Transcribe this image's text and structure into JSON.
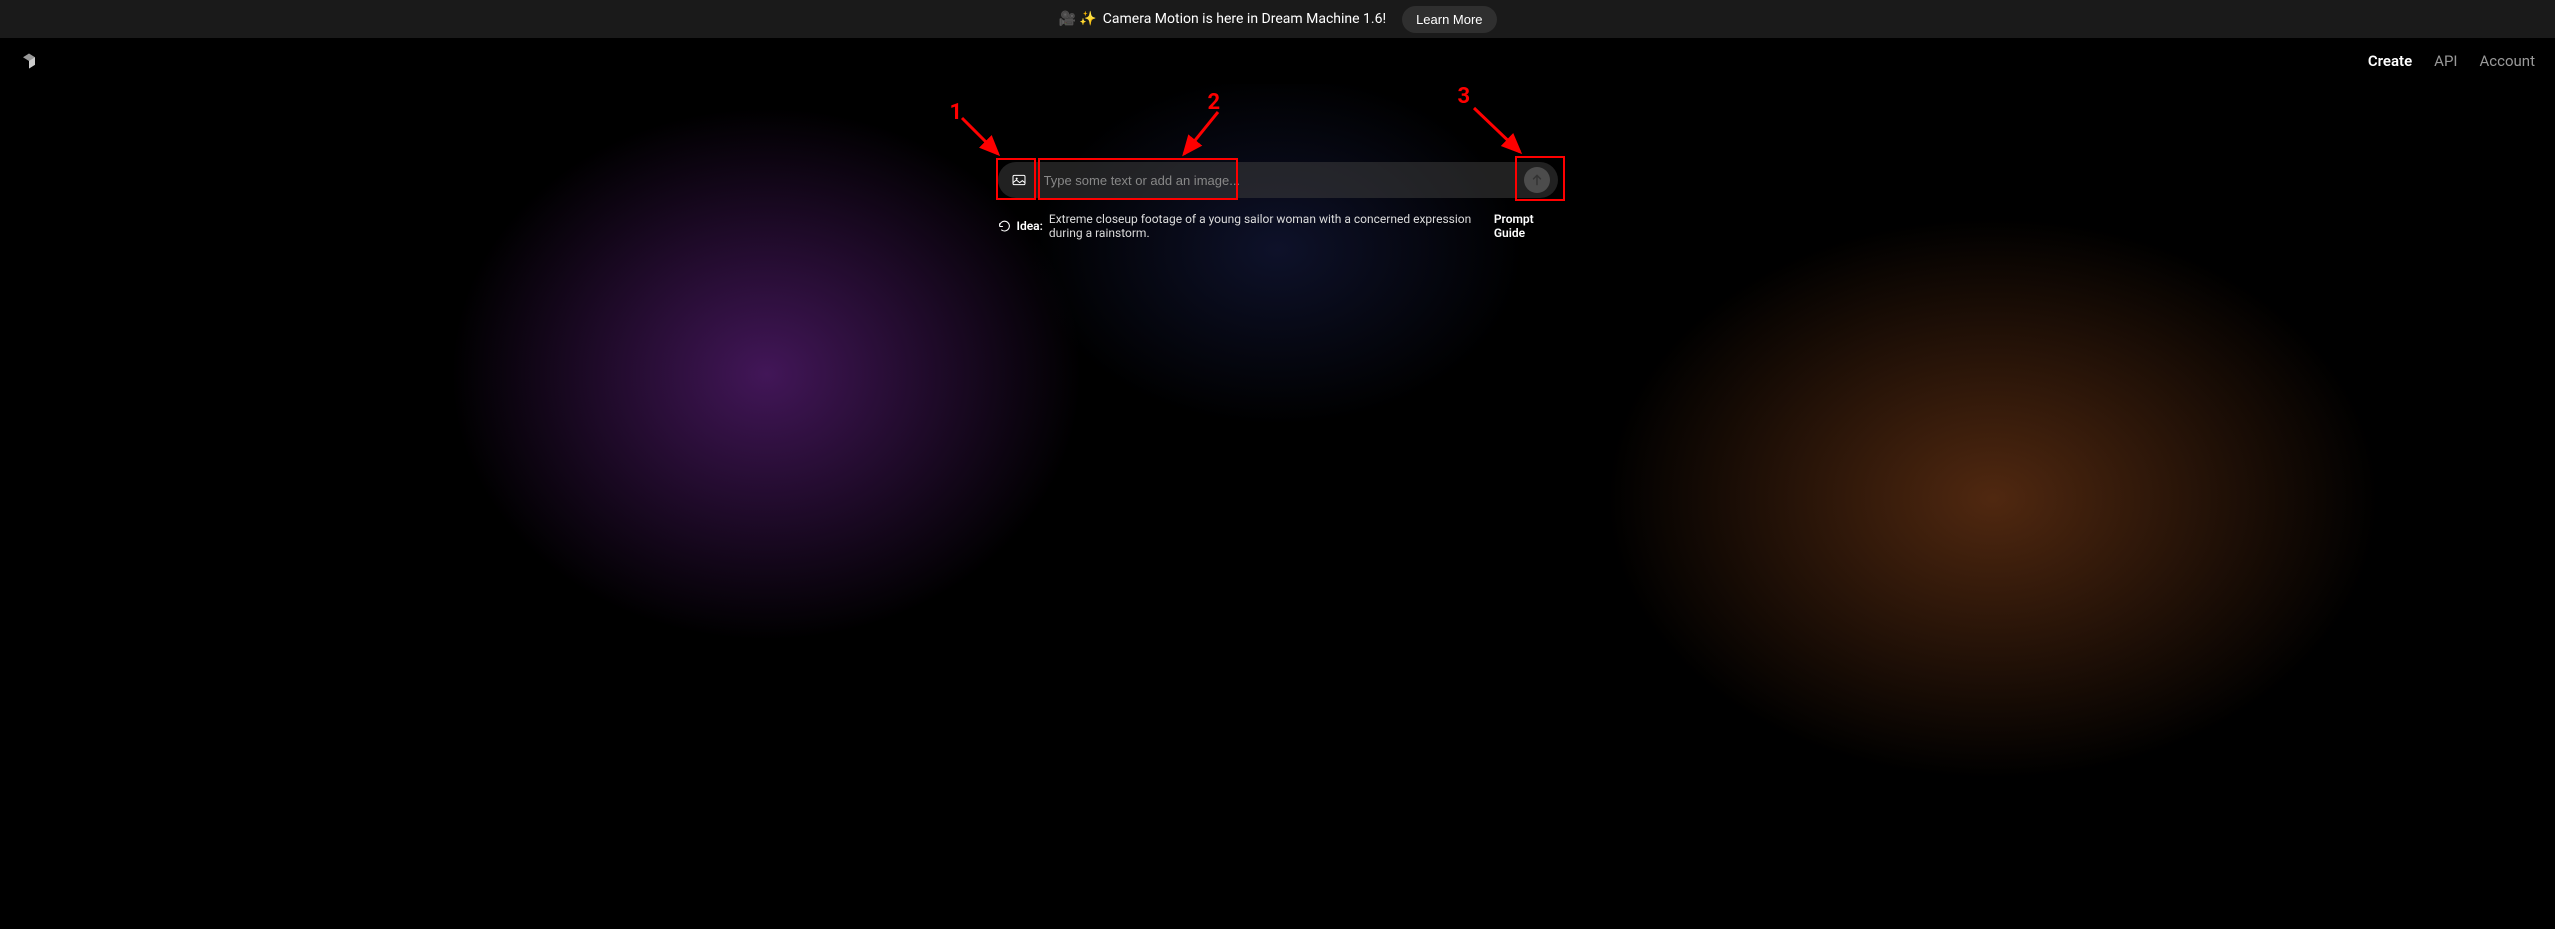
{
  "announcement": {
    "emoji": "🎥 ✨",
    "text": "Camera Motion is here in Dream Machine 1.6!",
    "button_label": "Learn More"
  },
  "nav": {
    "create": "Create",
    "api": "API",
    "account": "Account"
  },
  "prompt": {
    "placeholder": "Type some text or add an image..."
  },
  "idea": {
    "label": "Idea:",
    "text": "Extreme closeup footage of a young sailor woman with a concerned expression during a rainstorm."
  },
  "prompt_guide_label": "Prompt Guide",
  "annotations": {
    "one": "1",
    "two": "2",
    "three": "3"
  }
}
